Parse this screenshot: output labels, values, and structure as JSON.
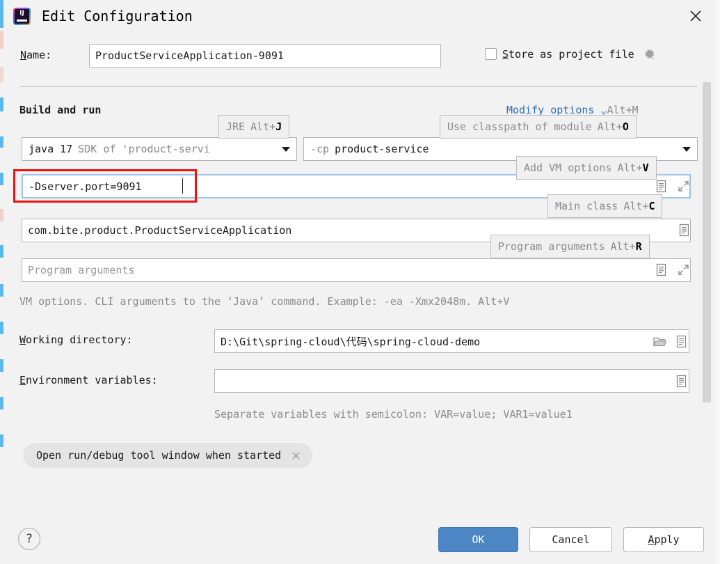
{
  "window": {
    "title": "Edit Configuration",
    "logo_icon": "intellij-idea-logo",
    "close_icon": "close-icon"
  },
  "name_row": {
    "label": "Name:",
    "label_mnemonic": "N",
    "value": "ProductServiceApplication-9091",
    "store_as_project_file": {
      "label": "Store as project file",
      "mnemonic": "S",
      "checked": false,
      "gear_icon": "gear-icon"
    }
  },
  "build_and_run": {
    "heading": "Build and run",
    "modify_options": {
      "label": "Modify options",
      "chevron": "⌄",
      "shortcut": "Alt+M"
    },
    "jre": {
      "main": "java 17",
      "sub": "SDK of 'product-servi",
      "dropdown_icon": "chevron-down-icon"
    },
    "classpath": {
      "flag": "-cp",
      "value": "product-service",
      "dropdown_icon": "chevron-down-icon"
    },
    "vm_options": {
      "value": "-Dserver.port=9091",
      "expand_icon": "expand-icon",
      "macros_icon": "insert-macro-icon",
      "focused": true,
      "annotation_color": "#ee1111"
    },
    "main_class": {
      "value": "com.bite.product.ProductServiceApplication",
      "macros_icon": "insert-macro-icon"
    },
    "program_arguments": {
      "placeholder": "Program arguments",
      "value": "",
      "expand_icon": "expand-icon",
      "macros_icon": "insert-macro-icon"
    },
    "hint": "VM options. CLI arguments to the ‘Java’ command. Example: -ea -Xmx2048m. Alt+V"
  },
  "working_directory": {
    "label": "Working directory:",
    "mnemonic": "W",
    "value": "D:\\Git\\spring-cloud\\代码\\spring-cloud-demo",
    "browse_icon": "folder-icon",
    "macros_icon": "insert-macro-icon"
  },
  "environment_variables": {
    "label": "Environment variables:",
    "mnemonic": "E",
    "value": "",
    "macros_icon": "insert-macro-icon",
    "hint": "Separate variables with semicolon: VAR=value; VAR1=value1"
  },
  "option_chips": [
    {
      "label": "Open run/debug tool window when started",
      "remove_icon": "close-icon"
    }
  ],
  "tooltips": [
    {
      "id": "jre",
      "text": "JRE",
      "shortcut_prefix": "Alt+",
      "shortcut_key": "J"
    },
    {
      "id": "classpath",
      "text": "Use classpath of module",
      "shortcut_prefix": "Alt+",
      "shortcut_key": "O"
    },
    {
      "id": "vm",
      "text": "Add VM options",
      "shortcut_prefix": "Alt+",
      "shortcut_key": "V"
    },
    {
      "id": "mainclass",
      "text": "Main class",
      "shortcut_prefix": "Alt+",
      "shortcut_key": "C"
    },
    {
      "id": "progargs",
      "text": "Program arguments",
      "shortcut_prefix": "Alt+",
      "shortcut_key": "R"
    }
  ],
  "buttons": {
    "help": "?",
    "ok": "OK",
    "cancel": "Cancel",
    "apply": "Apply",
    "apply_mnemonic": "A"
  },
  "colors": {
    "dialog_background": "#f2f2f2",
    "field_background": "#ffffff",
    "accent_blue": "#4d86c4",
    "link_blue": "#2a6fbb",
    "focus_border": "#9cc3ea",
    "annotation_red": "#ee1111",
    "hint_gray": "#8a8a8a"
  }
}
